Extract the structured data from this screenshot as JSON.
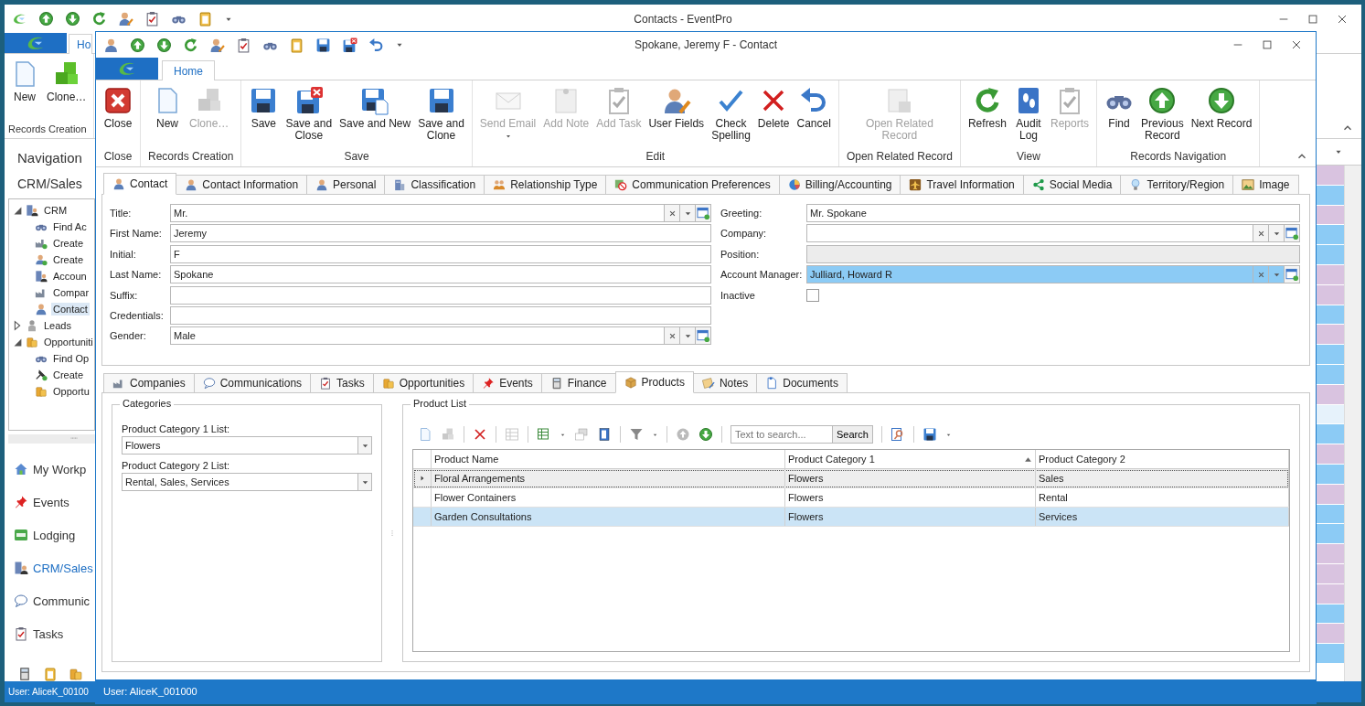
{
  "back_window": {
    "title": "Contacts - EventPro",
    "tab": "Ho",
    "ribbon": {
      "buttons": [
        {
          "label": "New",
          "disabled": false
        },
        {
          "label": "Clone…",
          "disabled": false
        }
      ],
      "group": "Records Creation"
    },
    "navigation": {
      "title": "Navigation",
      "section": "CRM/Sales",
      "tree": [
        {
          "label": "CRM",
          "expanded": true,
          "selected": false,
          "children": [
            {
              "label": "Find Ac",
              "selected": false
            },
            {
              "label": "Create",
              "selected": false
            },
            {
              "label": "Create",
              "selected": false
            },
            {
              "label": "Accoun",
              "selected": false
            },
            {
              "label": "Compar",
              "selected": false
            },
            {
              "label": "Contact",
              "selected": true
            }
          ]
        },
        {
          "label": "Leads",
          "expanded": false,
          "selected": false
        },
        {
          "label": "Opportuniti",
          "expanded": true,
          "selected": false,
          "children": [
            {
              "label": "Find Op",
              "selected": false
            },
            {
              "label": "Create",
              "selected": false
            },
            {
              "label": "Opportu",
              "selected": false
            }
          ]
        }
      ],
      "buttons": [
        {
          "label": "My Workp",
          "selected": false
        },
        {
          "label": "Events",
          "selected": false
        },
        {
          "label": "Lodging",
          "selected": false
        },
        {
          "label": "CRM/Sales",
          "selected": true
        },
        {
          "label": "Communic",
          "selected": false
        },
        {
          "label": "Tasks",
          "selected": false
        }
      ]
    },
    "status_bar": "User: AliceK_00100"
  },
  "window": {
    "title": "Spokane, Jeremy F - Contact",
    "ribbon": {
      "tabs": [
        {
          "label": "Home",
          "selected": true
        }
      ],
      "groups": [
        {
          "label": "Close",
          "buttons": [
            {
              "label": "Close",
              "disabled": false
            }
          ]
        },
        {
          "label": "Records Creation",
          "buttons": [
            {
              "label": "New",
              "disabled": false
            },
            {
              "label": "Clone…",
              "disabled": true
            }
          ]
        },
        {
          "label": "Save",
          "buttons": [
            {
              "label": "Save",
              "disabled": false
            },
            {
              "label": "Save and\nClose",
              "disabled": false
            },
            {
              "label": "Save and New",
              "disabled": false
            },
            {
              "label": "Save and\nClone",
              "disabled": false
            }
          ]
        },
        {
          "label": "Edit",
          "buttons": [
            {
              "label": "Send Email",
              "disabled": true,
              "dropdown": true
            },
            {
              "label": "Add Note",
              "disabled": true
            },
            {
              "label": "Add Task",
              "disabled": true
            },
            {
              "label": "User Fields",
              "disabled": false
            },
            {
              "label": "Check\nSpelling",
              "disabled": false
            },
            {
              "label": "Delete",
              "disabled": false
            },
            {
              "label": "Cancel",
              "disabled": false
            }
          ]
        },
        {
          "label": "Open Related Record",
          "buttons": [
            {
              "label": "Open Related\nRecord",
              "disabled": true
            }
          ]
        },
        {
          "label": "View",
          "buttons": [
            {
              "label": "Refresh",
              "disabled": false
            },
            {
              "label": "Audit\nLog",
              "disabled": false
            },
            {
              "label": "Reports",
              "disabled": true
            }
          ]
        },
        {
          "label": "Records Navigation",
          "buttons": [
            {
              "label": "Find",
              "disabled": false
            },
            {
              "label": "Previous\nRecord",
              "disabled": false
            },
            {
              "label": "Next Record",
              "disabled": false
            }
          ]
        }
      ]
    },
    "tabs": [
      {
        "label": "Contact",
        "selected": true
      },
      {
        "label": "Contact Information",
        "selected": false
      },
      {
        "label": "Personal",
        "selected": false
      },
      {
        "label": "Classification",
        "selected": false
      },
      {
        "label": "Relationship Type",
        "selected": false
      },
      {
        "label": "Communication Preferences",
        "selected": false
      },
      {
        "label": "Billing/Accounting",
        "selected": false
      },
      {
        "label": "Travel Information",
        "selected": false
      },
      {
        "label": "Social Media",
        "selected": false
      },
      {
        "label": "Territory/Region",
        "selected": false
      },
      {
        "label": "Image",
        "selected": false
      }
    ],
    "contact_form": {
      "left": [
        {
          "label": "Title:",
          "kind": "combo",
          "value": "Mr.",
          "disabled": false,
          "focused": false
        },
        {
          "label": "First Name:",
          "kind": "text",
          "value": "Jeremy",
          "disabled": false,
          "focused": false
        },
        {
          "label": "Initial:",
          "kind": "text",
          "value": "F",
          "disabled": false,
          "focused": false
        },
        {
          "label": "Last Name:",
          "kind": "text",
          "value": "Spokane",
          "disabled": false,
          "focused": false
        },
        {
          "label": "Suffix:",
          "kind": "text",
          "disabled": false,
          "focused": false
        },
        {
          "label": "Credentials:",
          "kind": "text",
          "disabled": false,
          "focused": false
        },
        {
          "label": "Gender:",
          "kind": "combo",
          "value": "Male",
          "disabled": false,
          "focused": false
        }
      ],
      "right": [
        {
          "label": "Greeting:",
          "kind": "text",
          "value": "Mr. Spokane",
          "disabled": false,
          "focused": false
        },
        {
          "label": "Company:",
          "kind": "combo",
          "disabled": false,
          "focused": false
        },
        {
          "label": "Position:",
          "kind": "text",
          "disabled": true,
          "focused": false
        },
        {
          "label": "Account Manager:",
          "kind": "combo",
          "value": "Julliard, Howard R",
          "disabled": false,
          "focused": true
        },
        {
          "label": "Inactive",
          "kind": "checkbox",
          "checked": false
        }
      ]
    },
    "detail_tabs": [
      {
        "label": "Companies",
        "selected": false
      },
      {
        "label": "Communications",
        "selected": false
      },
      {
        "label": "Tasks",
        "selected": false
      },
      {
        "label": "Opportunities",
        "selected": false
      },
      {
        "label": "Events",
        "selected": false
      },
      {
        "label": "Finance",
        "selected": false
      },
      {
        "label": "Products",
        "selected": true
      },
      {
        "label": "Notes",
        "selected": false
      },
      {
        "label": "Documents",
        "selected": false
      }
    ],
    "categories": {
      "title": "Categories",
      "lists": [
        {
          "label": "Product Category 1 List:",
          "value": "Flowers"
        },
        {
          "label": "Product Category 2 List:",
          "value": "Rental, Sales, Services"
        }
      ]
    },
    "product_list": {
      "title": "Product List",
      "search": {
        "placeholder": "Text to search...",
        "button": "Search"
      },
      "columns": [
        {
          "label": "Product Name",
          "sorted": false
        },
        {
          "label": "Product Category 1",
          "sorted": true
        },
        {
          "label": "Product Category 2",
          "sorted": false
        }
      ],
      "rows": [
        {
          "cells": [
            "Floral Arrangements",
            "Flowers",
            "Sales"
          ],
          "focused": true,
          "selected": false
        },
        {
          "cells": [
            "Flower Containers",
            "Flowers",
            "Rental"
          ],
          "focused": false,
          "selected": false
        },
        {
          "cells": [
            "Garden Consultations",
            "Flowers",
            "Services"
          ],
          "focused": false,
          "selected": true
        }
      ]
    },
    "status_bar": "User: AliceK_001000"
  }
}
